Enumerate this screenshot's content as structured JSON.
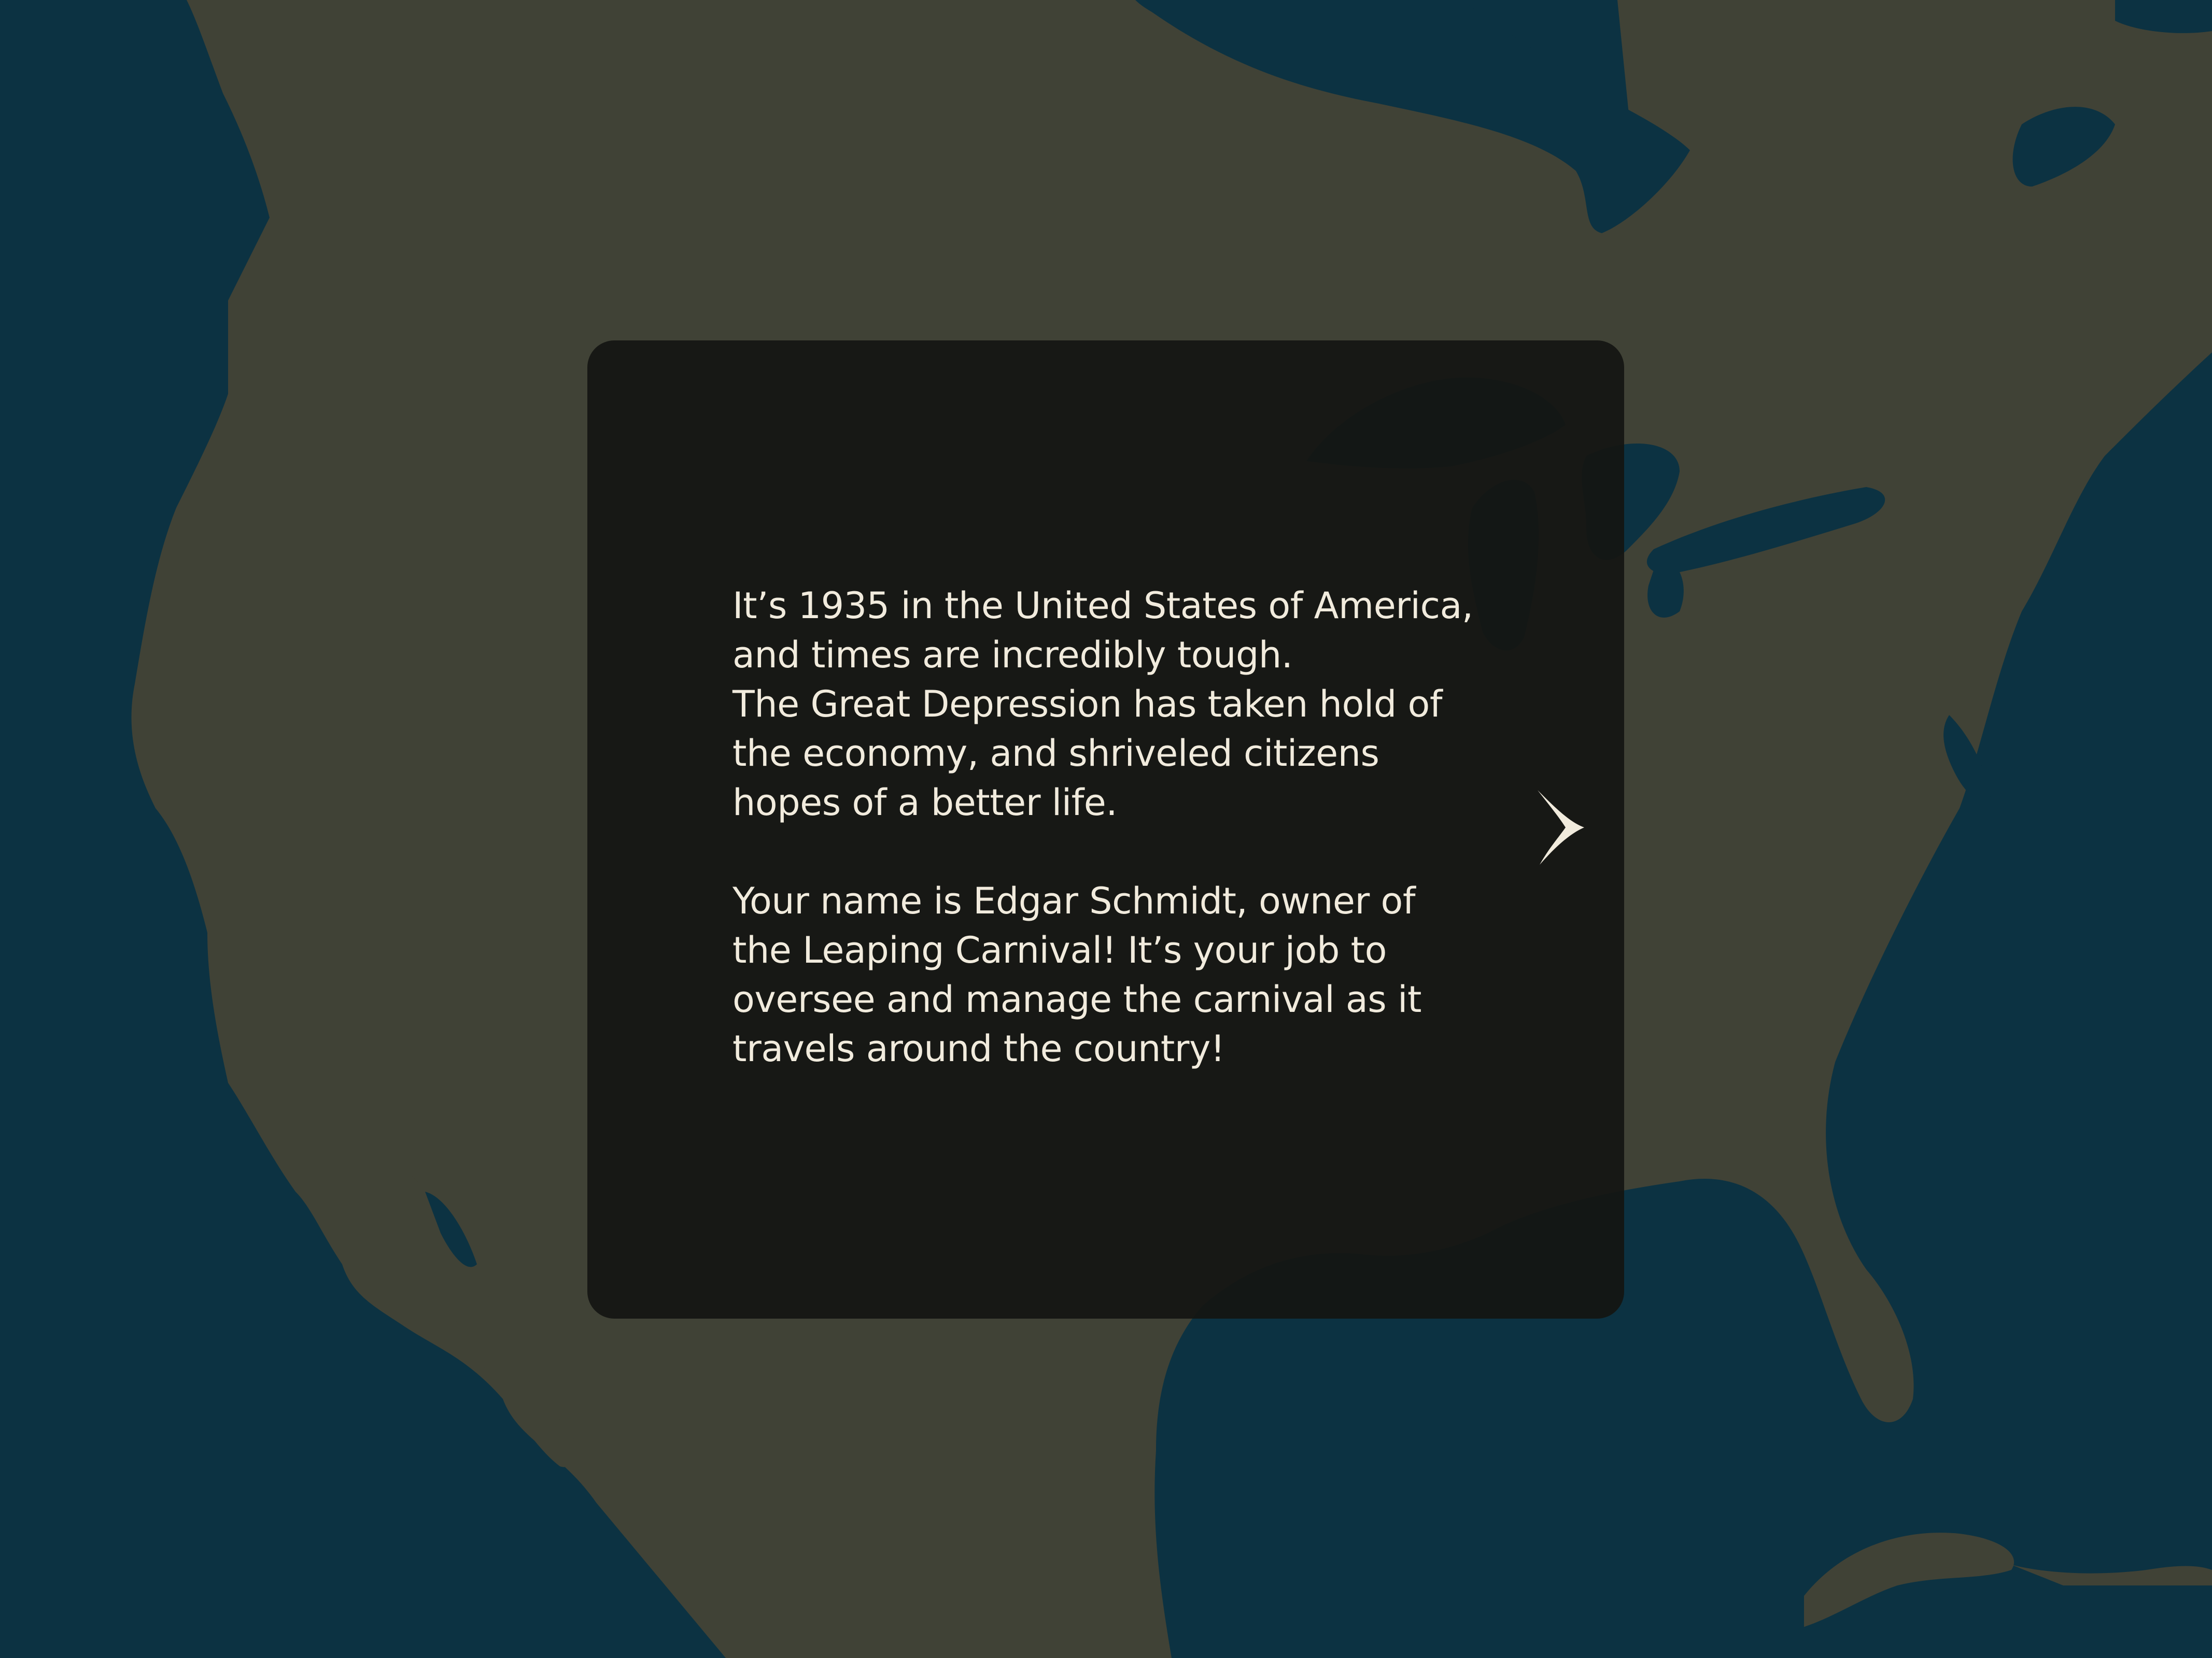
{
  "colors": {
    "ocean": "#0c3242",
    "land": "#404236",
    "panel": "#141612",
    "text": "#f1ebdd"
  },
  "intro": {
    "paragraph_1": [
      "It’s 1935 in the United States of America,",
      "and times are incredibly tough.",
      "The Great Depression has taken hold of",
      "the economy, and shriveled citizens",
      "hopes of a better life."
    ],
    "paragraph_2": [
      "Your name is Edgar Schmidt, owner of",
      "the Leaping Carnival! It’s your job to",
      "oversee and manage the carnival as it",
      "travels around the country!"
    ]
  },
  "controls": {
    "next_icon": "chevron-right-icon"
  }
}
